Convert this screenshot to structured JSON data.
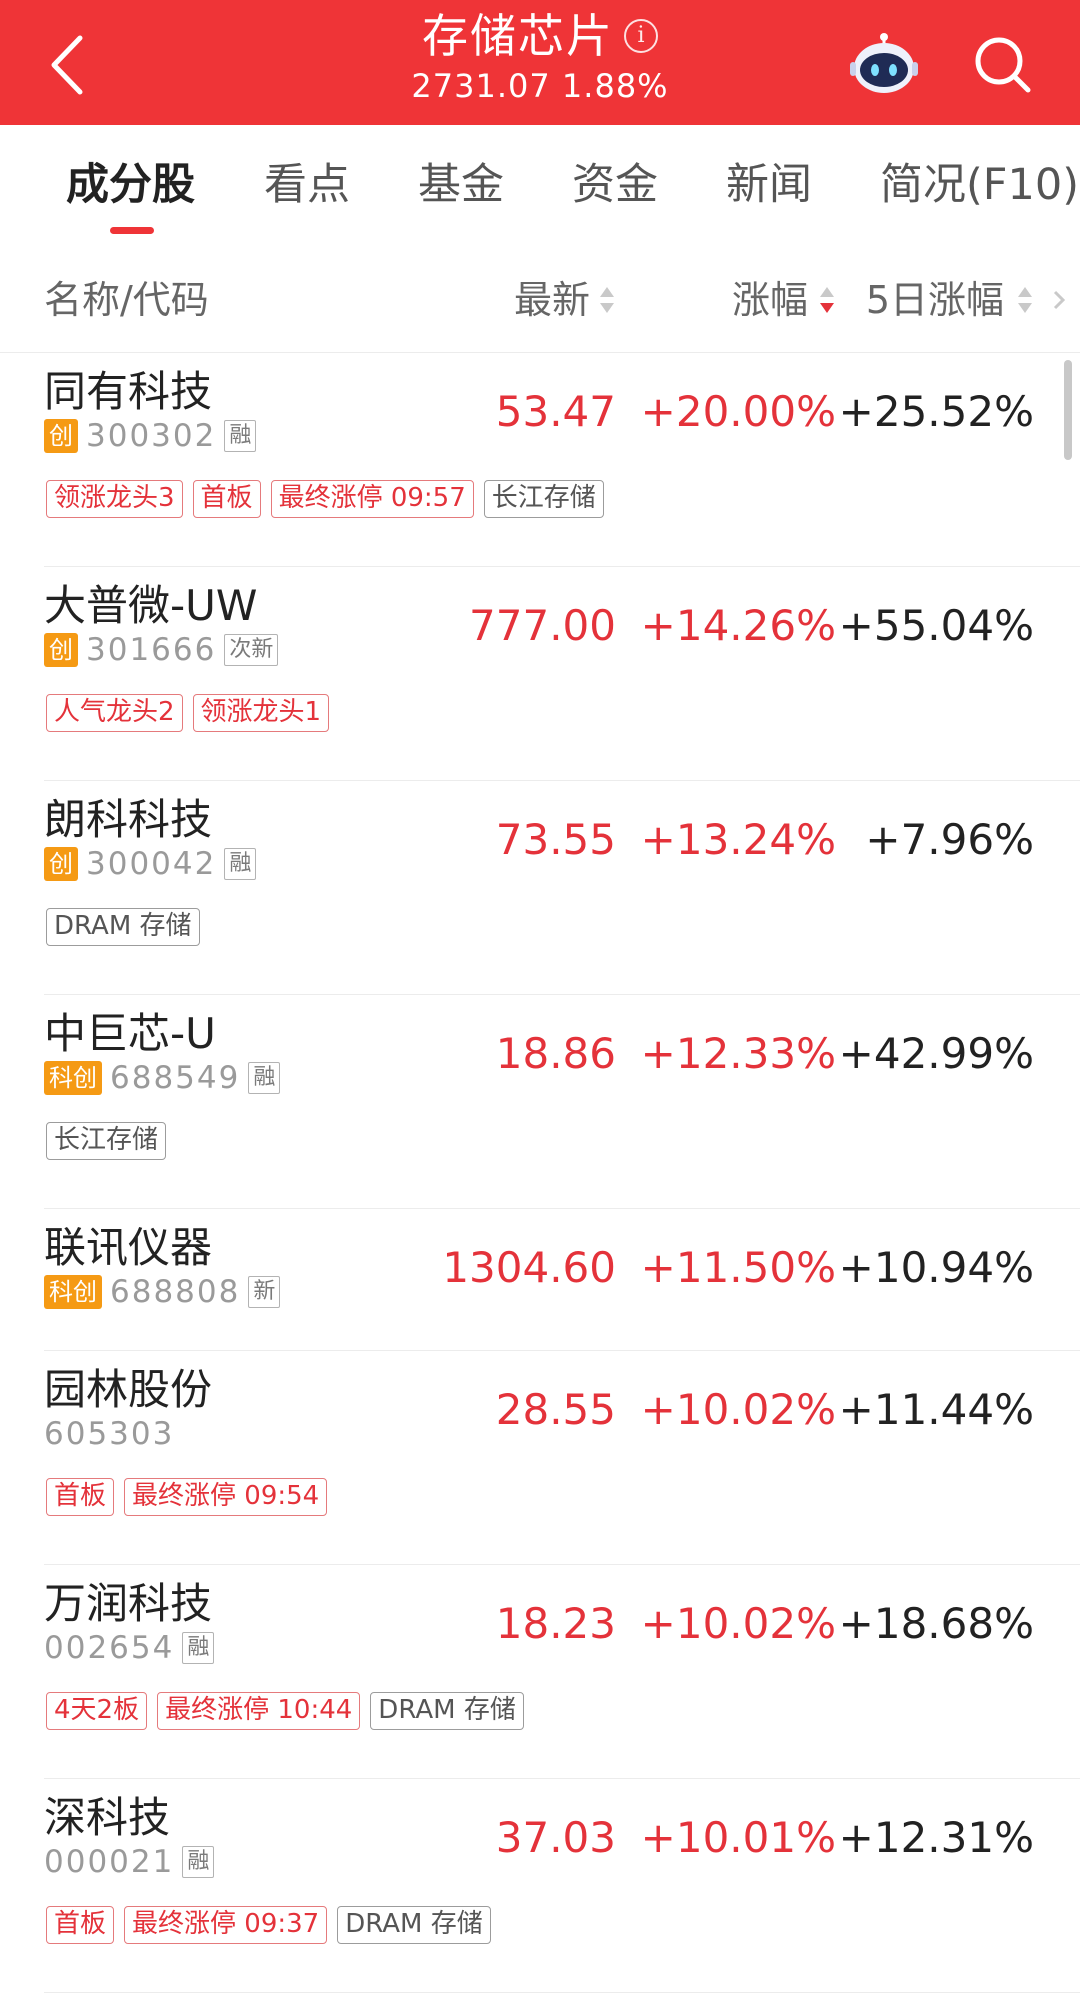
{
  "header": {
    "title": "存储芯片",
    "index_value": "2731.07",
    "index_change": "1.88%",
    "background_color": "#ef3437",
    "icons": [
      "back-arrow-icon",
      "info-icon",
      "robot-assistant-icon",
      "search-icon"
    ]
  },
  "tabs": [
    {
      "label": "成分股",
      "active": true
    },
    {
      "label": "看点",
      "active": false
    },
    {
      "label": "基金",
      "active": false
    },
    {
      "label": "资金",
      "active": false
    },
    {
      "label": "新闻",
      "active": false
    },
    {
      "label": "简况(F10)",
      "active": false
    }
  ],
  "columns": {
    "name": "名称/代码",
    "price": "最新",
    "change": "涨幅",
    "change_5d": "5日涨幅",
    "sorted_by": "change",
    "sort_direction": "desc"
  },
  "stocks": [
    {
      "name": "同有科技",
      "market": "创",
      "code": "300302",
      "flag": "融",
      "price": "53.47",
      "change": "+20.00%",
      "change_5d": "+25.52%",
      "tags": [
        {
          "text": "领涨龙头3",
          "style": "red"
        },
        {
          "text": "首板",
          "style": "red"
        },
        {
          "text": "最终涨停 09:57",
          "style": "red"
        },
        {
          "text": "长江存储",
          "style": "gray"
        }
      ]
    },
    {
      "name": "大普微-UW",
      "market": "创",
      "code": "301666",
      "flag": "次新",
      "price": "777.00",
      "change": "+14.26%",
      "change_5d": "+55.04%",
      "tags": [
        {
          "text": "人气龙头2",
          "style": "red"
        },
        {
          "text": "领涨龙头1",
          "style": "red"
        }
      ]
    },
    {
      "name": "朗科科技",
      "market": "创",
      "code": "300042",
      "flag": "融",
      "price": "73.55",
      "change": "+13.24%",
      "change_5d": "+7.96%",
      "tags": [
        {
          "text": "DRAM 存储",
          "style": "gray"
        }
      ]
    },
    {
      "name": "中巨芯-U",
      "market": "科创",
      "code": "688549",
      "flag": "融",
      "price": "18.86",
      "change": "+12.33%",
      "change_5d": "+42.99%",
      "tags": [
        {
          "text": "长江存储",
          "style": "gray"
        }
      ]
    },
    {
      "name": "联讯仪器",
      "market": "科创",
      "code": "688808",
      "flag": "新",
      "price": "1304.60",
      "change": "+11.50%",
      "change_5d": "+10.94%",
      "tags": []
    },
    {
      "name": "园林股份",
      "market": "",
      "code": "605303",
      "flag": "",
      "price": "28.55",
      "change": "+10.02%",
      "change_5d": "+11.44%",
      "tags": [
        {
          "text": "首板",
          "style": "red"
        },
        {
          "text": "最终涨停 09:54",
          "style": "red"
        }
      ]
    },
    {
      "name": "万润科技",
      "market": "",
      "code": "002654",
      "flag": "融",
      "price": "18.23",
      "change": "+10.02%",
      "change_5d": "+18.68%",
      "tags": [
        {
          "text": "4天2板",
          "style": "red"
        },
        {
          "text": "最终涨停 10:44",
          "style": "red"
        },
        {
          "text": "DRAM 存储",
          "style": "gray"
        }
      ]
    },
    {
      "name": "深科技",
      "market": "",
      "code": "000021",
      "flag": "融",
      "price": "37.03",
      "change": "+10.01%",
      "change_5d": "+12.31%",
      "tags": [
        {
          "text": "首板",
          "style": "red"
        },
        {
          "text": "最终涨停 09:37",
          "style": "red"
        },
        {
          "text": "DRAM 存储",
          "style": "gray"
        }
      ]
    }
  ]
}
